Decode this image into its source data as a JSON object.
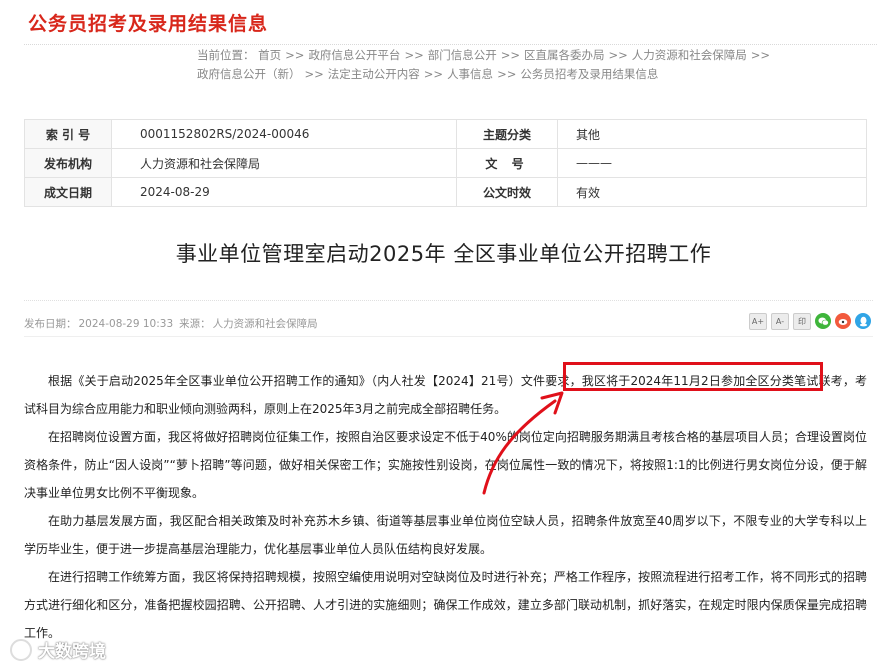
{
  "section_title": "公务员招考及录用结果信息",
  "breadcrumb": {
    "prefix": "当前位置：",
    "separator": ">>",
    "items": [
      "首页",
      "政府信息公开平台",
      "部门信息公开",
      "区直属各委办局",
      "人力资源和社会保障局",
      "政府信息公开（新）",
      "法定主动公开内容",
      "人事信息",
      "公务员招考及录用结果信息"
    ]
  },
  "meta_table": {
    "index_label": "索 引 号",
    "index_value": "0001152802RS/2024-00046",
    "topic_label": "主题分类",
    "topic_value": "其他",
    "publisher_label": "发布机构",
    "publisher_value": "人力资源和社会保障局",
    "doc_no_label": "文 号",
    "doc_no_value": "———",
    "date_label": "成文日期",
    "date_value": "2024-08-29",
    "valid_label": "公文时效",
    "valid_value": "有效"
  },
  "headline": "事业单位管理室启动2025年 全区事业单位公开招聘工作",
  "pub_info": {
    "date_label": "发布日期：",
    "date_value": "2024-08-29 10:33",
    "source_label": "来源：",
    "source_value": "人力资源和社会保障局"
  },
  "tools": {
    "font_increase": "A+",
    "font_decrease": "A-",
    "print": "印"
  },
  "paragraphs": [
    "根据《关于启动2025年全区事业单位公开招聘工作的通知》（内人社发【2024】21号）文件要求，我区将于2024年11月2日参加全区分类笔试联考，考试科目为综合应用能力和职业倾向测验两科，原则上在2025年3月之前完成全部招聘任务。",
    "在招聘岗位设置方面，我区将做好招聘岗位征集工作，按照自治区要求设定不低于40%的岗位定向招聘服务期满且考核合格的基层项目人员；合理设置岗位资格条件，防止“因人设岗”“萝卜招聘”等问题，做好相关保密工作；实施按性别设岗，在岗位属性一致的情况下，将按照1:1的比例进行男女岗位分设，便于解决事业单位男女比例不平衡现象。",
    "在助力基层发展方面，我区配合相关政策及时补充苏木乡镇、街道等基层事业单位岗位空缺人员，招聘条件放宽至40周岁以下，不限专业的大学专科以上学历毕业生，便于进一步提高基层治理能力，优化基层事业单位人员队伍结构良好发展。",
    "在进行招聘工作统筹方面，我区将保持招聘规模，按照空编使用说明对空缺岗位及时进行补充；严格工作程序，按照流程进行招考工作，将不同形式的招聘方式进行细化和区分，准备把握校园招聘、公开招聘、人才引进的实施细则；确保工作成效，建立多部门联动机制，抓好落实，在规定时限内保质保量完成招聘工作。"
  ],
  "watermark": "大数跨境",
  "colors": {
    "title_red": "#d8271b",
    "highlight_red": "#e0101a"
  }
}
